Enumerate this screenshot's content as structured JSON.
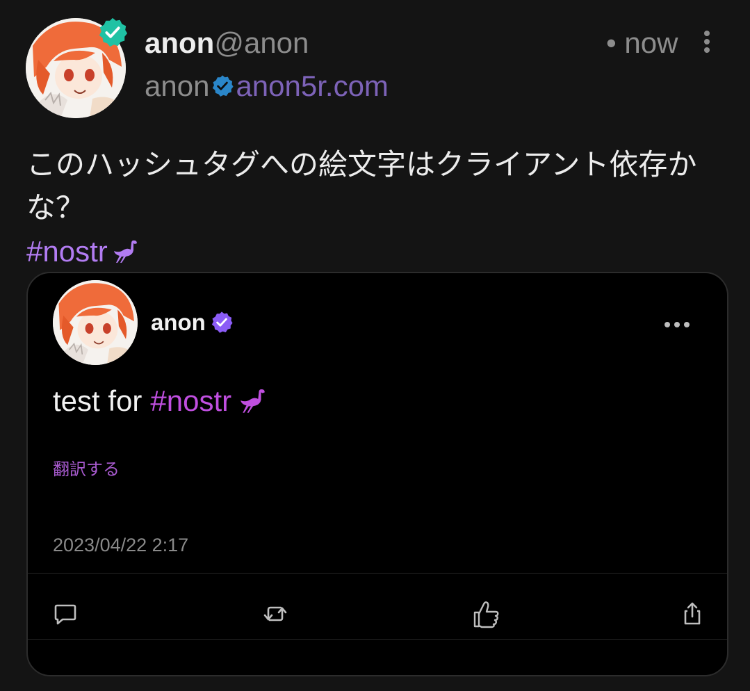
{
  "author": {
    "display_name": "anon",
    "handle": "@anon",
    "nip05_name": "anon",
    "nip05_domain": "anon5r.com",
    "verified": true
  },
  "meta": {
    "time": "• now"
  },
  "post": {
    "text": "このハッシュタグへの絵文字はクライアント依存かな？",
    "hashtag": "#nostr",
    "hashtag_emoji": "ostrich"
  },
  "quoted": {
    "display_name": "anon",
    "text_prefix": "test for",
    "hashtag": "#nostr",
    "hashtag_emoji": "ostrich",
    "translate_label": "翻訳する",
    "timestamp": "2023/04/22 2:17"
  },
  "actions": [
    {
      "name": "reply",
      "icon": "speech-bubble-icon"
    },
    {
      "name": "repost",
      "icon": "repost-icon"
    },
    {
      "name": "like",
      "icon": "thumbs-up-icon"
    },
    {
      "name": "share",
      "icon": "share-icon"
    }
  ],
  "colors": {
    "background": "#141414",
    "card_background": "#000000",
    "hashtag": "#b27cf2",
    "quoted_hashtag": "#c04fe0",
    "nip05_domain": "#7d63b8",
    "verified_teal": "#1fc2a4",
    "verified_blue": "#2a86c9",
    "verified_purple": "#8b5cf6"
  }
}
